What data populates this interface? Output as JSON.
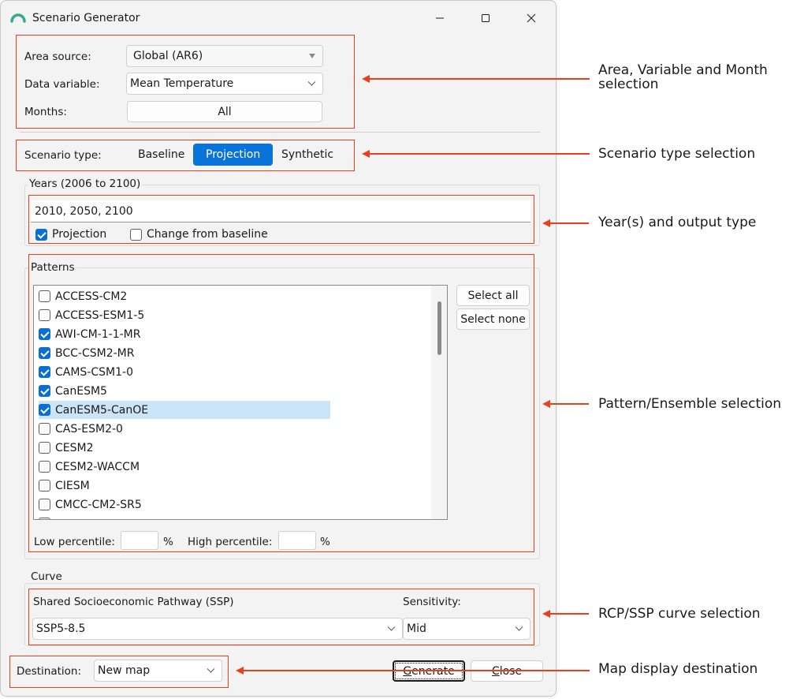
{
  "window": {
    "title": "Scenario Generator"
  },
  "area": {
    "area_source_label": "Area source:",
    "area_source_value": "Global (AR6)",
    "data_variable_label": "Data variable:",
    "data_variable_value": "Mean Temperature",
    "months_label": "Months:",
    "months_value": "All"
  },
  "scenario": {
    "label": "Scenario type:",
    "options": [
      "Baseline",
      "Projection",
      "Synthetic"
    ],
    "selected": "Projection"
  },
  "years": {
    "group_title": "Years (2006 to 2100)",
    "value": "2010, 2050, 2100",
    "projection_label": "Projection",
    "projection_checked": true,
    "change_label": "Change from baseline",
    "change_checked": false
  },
  "patterns": {
    "group_title": "Patterns",
    "items": [
      {
        "label": "ACCESS-CM2",
        "checked": false
      },
      {
        "label": "ACCESS-ESM1-5",
        "checked": false
      },
      {
        "label": "AWI-CM-1-1-MR",
        "checked": true
      },
      {
        "label": "BCC-CSM2-MR",
        "checked": true
      },
      {
        "label": "CAMS-CSM1-0",
        "checked": true
      },
      {
        "label": "CanESM5",
        "checked": true
      },
      {
        "label": "CanESM5-CanOE",
        "checked": true,
        "selected": true
      },
      {
        "label": "CAS-ESM2-0",
        "checked": false
      },
      {
        "label": "CESM2",
        "checked": false
      },
      {
        "label": "CESM2-WACCM",
        "checked": false
      },
      {
        "label": "CIESM",
        "checked": false
      },
      {
        "label": "CMCC-CM2-SR5",
        "checked": false
      }
    ],
    "select_all_label": "Select all",
    "select_none_label": "Select none",
    "low_percentile_label": "Low percentile:",
    "high_percentile_label": "High percentile:",
    "percent_sign": "%"
  },
  "curve": {
    "group_title": "Curve",
    "ssp_label": "Shared Socioeconomic Pathway (SSP)",
    "ssp_value": "SSP5-8.5",
    "sensitivity_label": "Sensitivity:",
    "sensitivity_value": "Mid"
  },
  "footer": {
    "destination_label": "Destination:",
    "destination_value": "New map",
    "generate_first": "G",
    "generate_rest": "enerate",
    "close_first": "C",
    "close_rest": "lose"
  },
  "annotations": [
    {
      "text": "Area, Variable and Month selection"
    },
    {
      "text": "Scenario type selection"
    },
    {
      "text": "Year(s) and output type"
    },
    {
      "text": "Pattern/Ensemble selection"
    },
    {
      "text": "RCP/SSP curve selection"
    },
    {
      "text": "Map display destination"
    }
  ],
  "colors": {
    "accent": "#0a73d9",
    "annotation": "#e8401c",
    "selection": "#cce4f7"
  }
}
